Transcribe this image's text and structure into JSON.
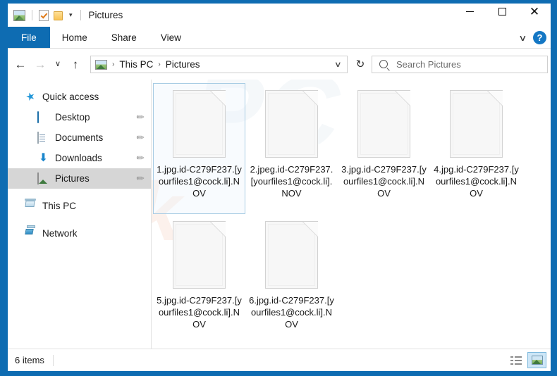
{
  "window": {
    "title": "Pictures",
    "quick_access_toolbar": [
      {
        "name": "picture-icon",
        "label": "Pictures"
      },
      {
        "name": "properties-icon",
        "label": "Properties"
      },
      {
        "name": "new-folder-icon",
        "label": "New folder"
      },
      {
        "name": "chevron-down-icon",
        "label": "Customize Quick Access Toolbar",
        "glyph": "▾"
      }
    ],
    "controls": {
      "minimize": "─",
      "maximize": "□",
      "close": "✕"
    }
  },
  "ribbon": {
    "tabs": [
      {
        "label": "File",
        "active": true
      },
      {
        "label": "Home",
        "active": false
      },
      {
        "label": "Share",
        "active": false
      },
      {
        "label": "View",
        "active": false
      }
    ],
    "expand_glyph": "∨",
    "help_glyph": "?"
  },
  "navigation": {
    "back_glyph": "←",
    "forward_glyph": "→",
    "recent_glyph": "∨",
    "up_glyph": "↑",
    "refresh_glyph": "↻",
    "address_chevron": "∨",
    "breadcrumbs": [
      "This PC",
      "Pictures"
    ],
    "separator": "›"
  },
  "search": {
    "placeholder": "Search Pictures",
    "value": ""
  },
  "sidebar": {
    "items": [
      {
        "label": "Quick access",
        "icon": "star-icon",
        "indent": false,
        "pinned": false,
        "selected": false
      },
      {
        "label": "Desktop",
        "icon": "desktop-icon",
        "indent": true,
        "pinned": true,
        "selected": false
      },
      {
        "label": "Documents",
        "icon": "documents-icon",
        "indent": true,
        "pinned": true,
        "selected": false
      },
      {
        "label": "Downloads",
        "icon": "downloads-icon",
        "indent": true,
        "pinned": true,
        "selected": false
      },
      {
        "label": "Pictures",
        "icon": "pictures-icon",
        "indent": true,
        "pinned": true,
        "selected": true
      },
      {
        "label": "This PC",
        "icon": "this-pc-icon",
        "indent": false,
        "pinned": false,
        "selected": false
      },
      {
        "label": "Network",
        "icon": "network-icon",
        "indent": false,
        "pinned": false,
        "selected": false
      }
    ],
    "pin_glyph": "✐"
  },
  "files": [
    {
      "name": "1.jpg.id-C279F237.[yourfiles1@cock.li].NOV",
      "selected": true
    },
    {
      "name": "2.jpeg.id-C279F237.[yourfiles1@cock.li].NOV",
      "selected": false
    },
    {
      "name": "3.jpg.id-C279F237.[yourfiles1@cock.li].NOV",
      "selected": false
    },
    {
      "name": "4.jpg.id-C279F237.[yourfiles1@cock.li].NOV",
      "selected": false
    },
    {
      "name": "5.jpg.id-C279F237.[yourfiles1@cock.li].NOV",
      "selected": false
    },
    {
      "name": "6.jpg.id-C279F237.[yourfiles1@cock.li].NOV",
      "selected": false
    }
  ],
  "watermark": {
    "text": "risk",
    "text2": "PC"
  },
  "status": {
    "item_count": "6 items",
    "views": [
      {
        "name": "details-view-button",
        "active": false
      },
      {
        "name": "large-icons-view-button",
        "active": true
      }
    ]
  },
  "colors": {
    "accent": "#0e6cb2",
    "selection": "#a8cce4",
    "sidebar_selected": "#d6d6d6"
  }
}
